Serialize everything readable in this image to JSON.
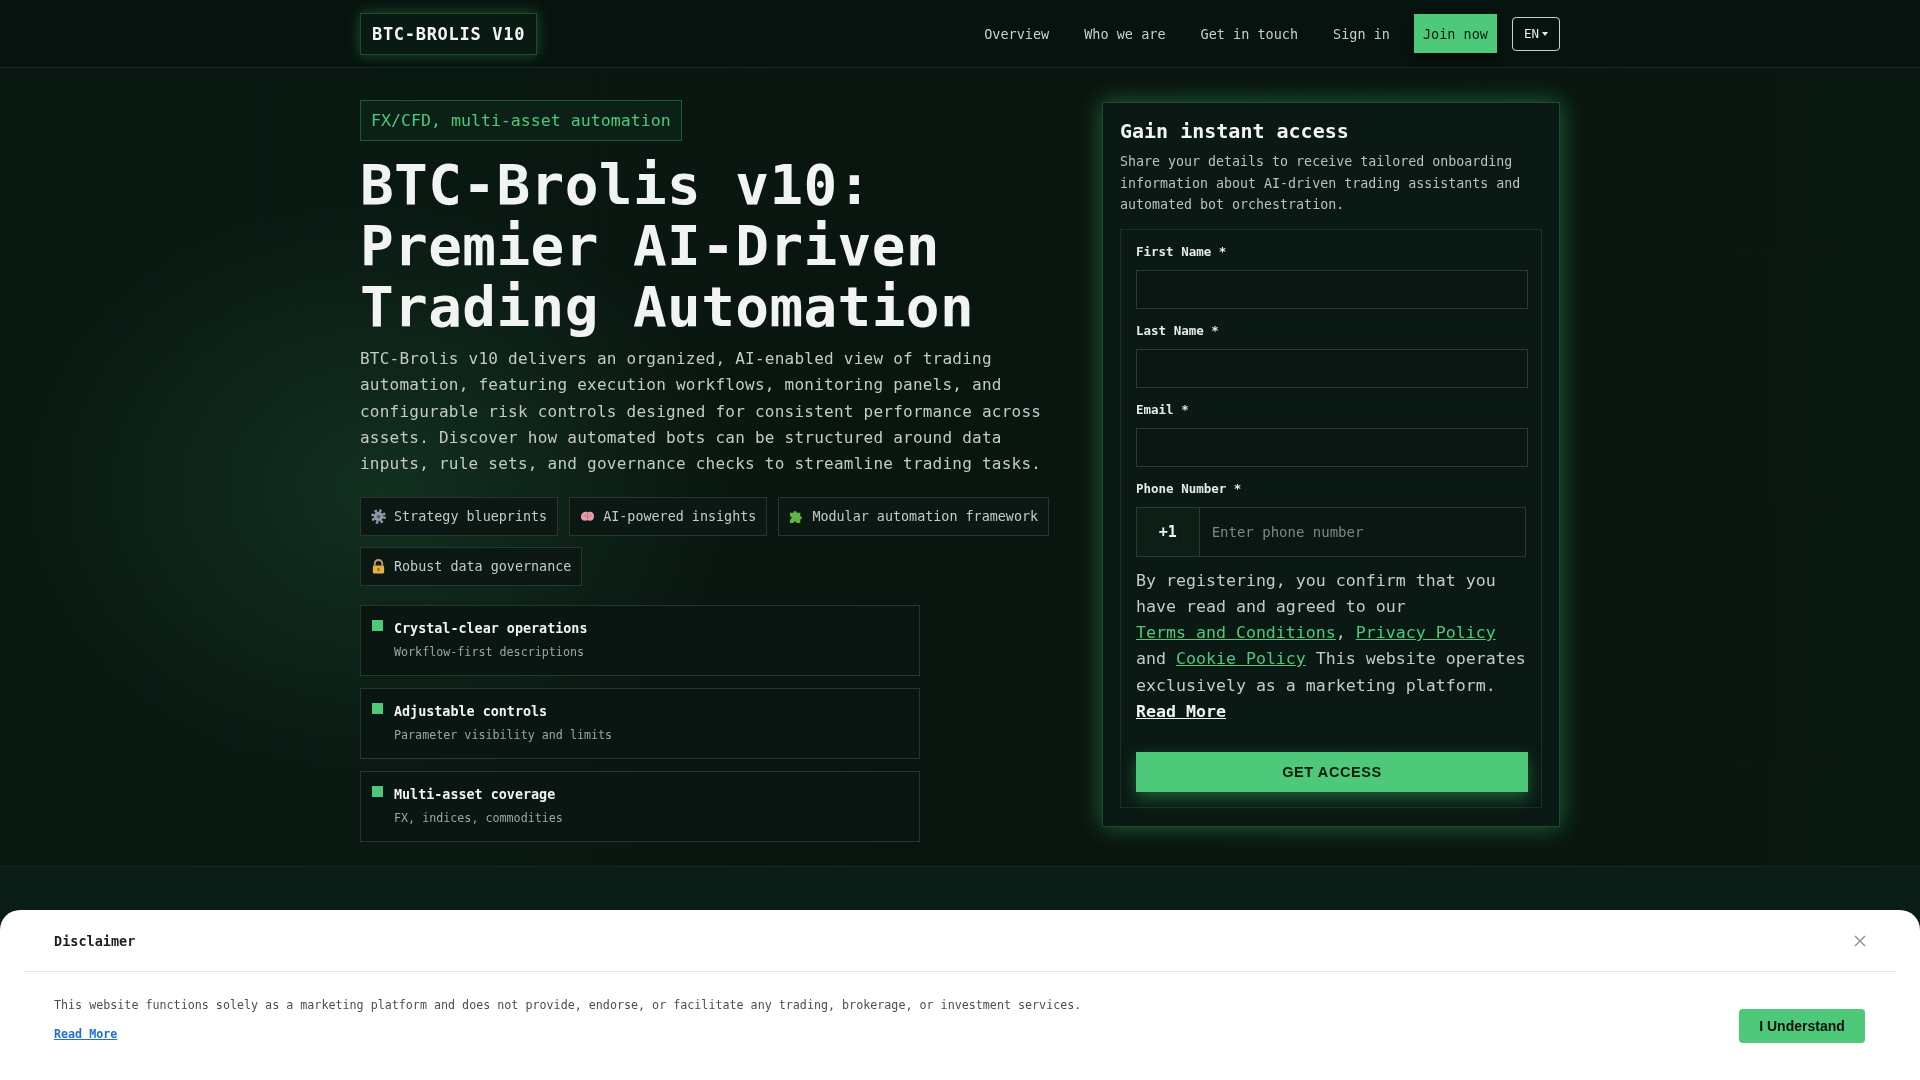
{
  "header": {
    "logo": "BTC-BROLIS V10",
    "nav": [
      {
        "label": "Overview",
        "kind": "link"
      },
      {
        "label": "Who we are",
        "kind": "link"
      },
      {
        "label": "Get in touch",
        "kind": "link"
      },
      {
        "label": "Sign in",
        "kind": "link"
      },
      {
        "label": "Join now",
        "kind": "button"
      }
    ],
    "language": "EN"
  },
  "hero": {
    "badge": "FX/CFD, multi-asset automation",
    "title": "BTC-Brolis v10: Premier AI-Driven Trading Automation",
    "description": "BTC-Brolis v10 delivers an organized, AI-enabled view of trading automation, featuring execution workflows, monitoring panels, and configurable risk controls designed for consistent performance across assets. Discover how automated bots can be structured around data inputs, rule sets, and governance checks to streamline trading tasks.",
    "tags": [
      "Strategy blueprints",
      "AI-powered insights",
      "Modular automation framework",
      "Robust data governance"
    ],
    "features": [
      {
        "title": "Crystal-clear operations",
        "subtitle": "Workflow-first descriptions"
      },
      {
        "title": "Adjustable controls",
        "subtitle": "Parameter visibility and limits"
      },
      {
        "title": "Multi-asset coverage",
        "subtitle": "FX, indices, commodities"
      }
    ]
  },
  "form": {
    "title": "Gain instant access",
    "description": "Share your details to receive tailored onboarding information about AI-driven trading assistants and automated bot orchestration.",
    "fields": [
      {
        "label": "First Name *",
        "kind": "text"
      },
      {
        "label": "Last Name *",
        "kind": "text"
      },
      {
        "label": "Email *",
        "kind": "email"
      },
      {
        "label": "Phone Number *",
        "kind": "phone",
        "prefix": "+1",
        "placeholder": "Enter phone number"
      }
    ],
    "consent": [
      {
        "kind": "text",
        "text": "By registering, you confirm that you have read and agreed to our "
      },
      {
        "kind": "link",
        "text": "Terms and Conditions"
      },
      {
        "kind": "text",
        "text": ", "
      },
      {
        "kind": "link",
        "text": "Privacy Policy"
      },
      {
        "kind": "text",
        "text": " and "
      },
      {
        "kind": "link",
        "text": "Cookie Policy"
      },
      {
        "kind": "text",
        "text": " This website operates exclusively as a marketing platform. "
      },
      {
        "kind": "more",
        "text": "Read More"
      }
    ],
    "submit": "GET ACCESS"
  },
  "disclaimer": {
    "title": "Disclaimer",
    "text": "This website functions solely as a marketing platform and does not provide, endorse, or facilitate any trading, brokerage, or investment services.",
    "link": "Read More",
    "button": "I Understand"
  }
}
